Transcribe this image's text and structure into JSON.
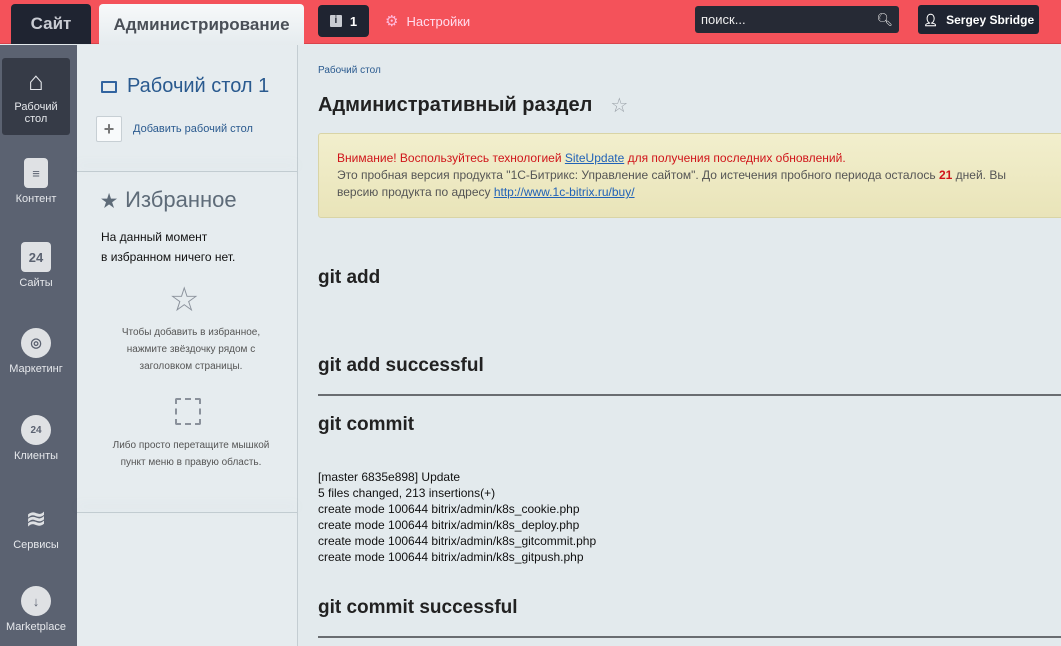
{
  "topbar": {
    "site_tab": "Сайт",
    "admin_tab": "Администрирование",
    "notifications_count": "1",
    "info_glyph": "i",
    "settings_label": "Настройки",
    "search_placeholder": "поиск...",
    "user_name": "Sergey Sbridge",
    "accent_color": "#f4525a"
  },
  "nav": [
    {
      "label": "Рабочий стол",
      "icon": "home-icon"
    },
    {
      "label": "Контент",
      "icon": "document-icon"
    },
    {
      "label": "Сайты",
      "icon": "calendar-24-icon",
      "glyph": "24"
    },
    {
      "label": "Маркетинг",
      "icon": "target-icon"
    },
    {
      "label": "Клиенты",
      "icon": "cloud-24-icon",
      "glyph": "24"
    },
    {
      "label": "Сервисы",
      "icon": "layers-icon"
    },
    {
      "label": "Marketplace",
      "icon": "cloud-download-icon"
    }
  ],
  "panel": {
    "desktop_title": "Рабочий стол 1",
    "add_desktop": "Добавить рабочий стол",
    "favorites_title": "Избранное",
    "empty_line1": "На данный момент",
    "empty_line2": "в избранном ничего нет.",
    "hint1": "Чтобы добавить в избранное, нажмите звёздочку рядом с заголовком страницы.",
    "hint2": "Либо просто перетащите мышкой пункт меню в правую область."
  },
  "main": {
    "breadcrumb": "Рабочий стол",
    "title": "Административный раздел",
    "notice": {
      "warn_prefix": "Внимание! Воспользуйтесь технологией ",
      "warn_link": "SiteUpdate",
      "warn_suffix": " для получения последних обновлений.",
      "trial_text": "Это пробная версия продукта \"1С-Битрикс: Управление сайтом\". До истечения пробного периода осталось ",
      "days": "21",
      "trial_suffix": " дней. Вы",
      "buy_prefix": "версию продукта по адресу ",
      "buy_link": "http://www.1c-bitrix.ru/buy/"
    },
    "sections": [
      "git add",
      "git add successful",
      "git commit",
      "git commit successful"
    ],
    "commit_output": [
      "[master 6835e898] Update",
      "5 files changed, 213 insertions(+)",
      "create mode 100644 bitrix/admin/k8s_cookie.php",
      "create mode 100644 bitrix/admin/k8s_deploy.php",
      "create mode 100644 bitrix/admin/k8s_gitcommit.php",
      "create mode 100644 bitrix/admin/k8s_gitpush.php"
    ]
  }
}
